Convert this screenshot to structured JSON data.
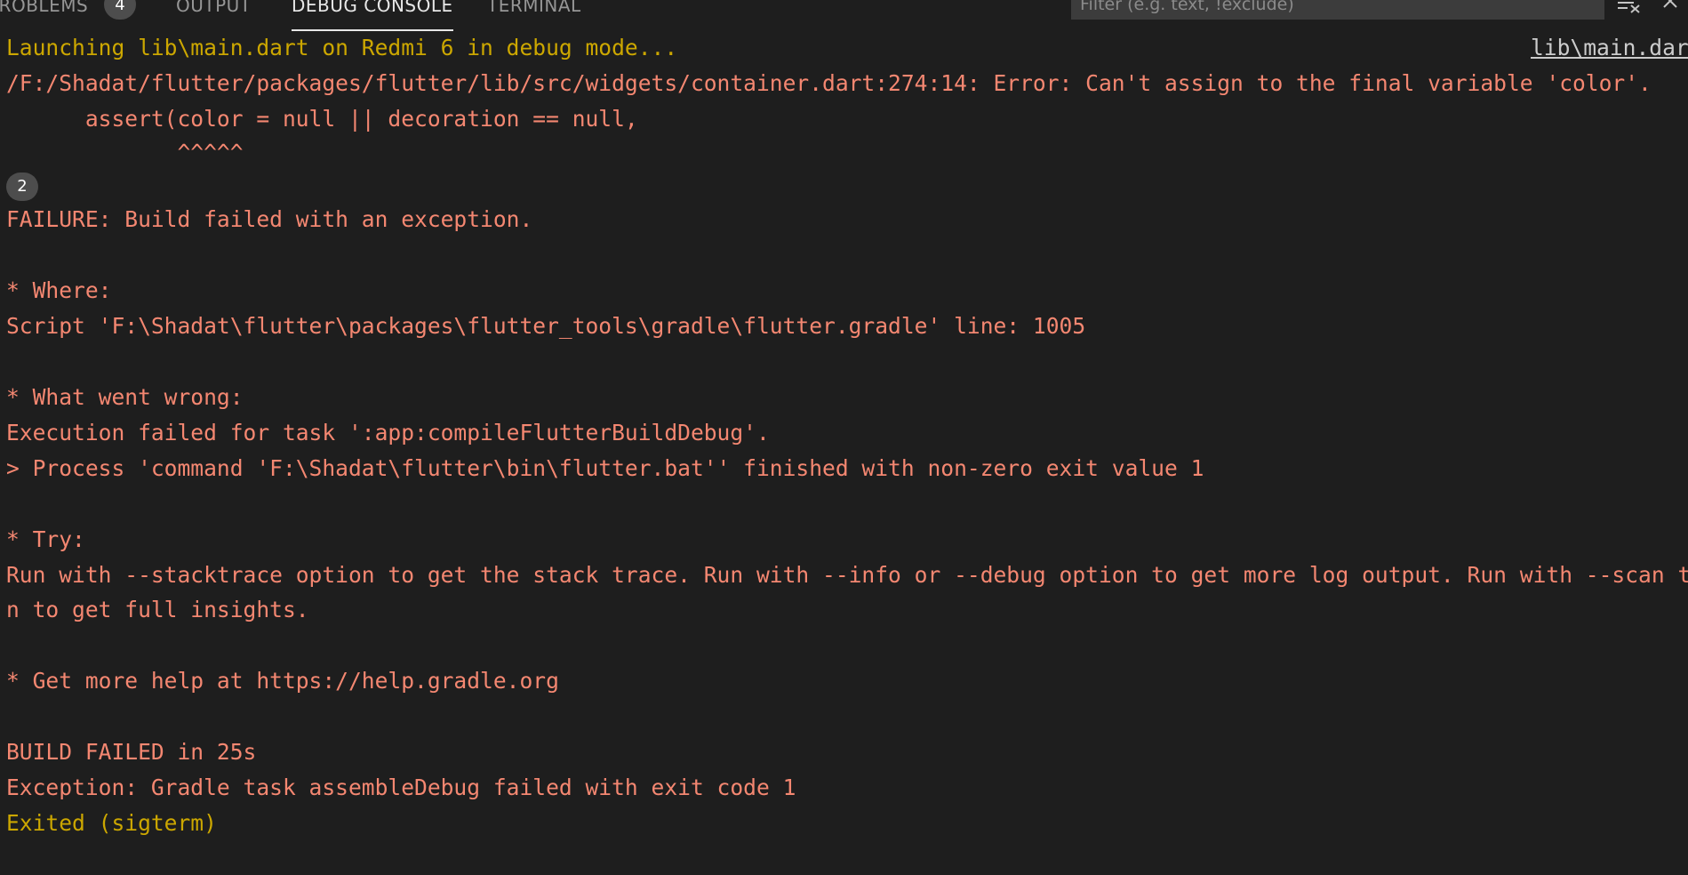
{
  "tabs": {
    "problems": {
      "label": "PROBLEMS",
      "count": "4"
    },
    "output": {
      "label": "OUTPUT"
    },
    "debug_console": {
      "label": "DEBUG CONSOLE"
    },
    "terminal": {
      "label": "TERMINAL"
    }
  },
  "filter": {
    "placeholder": "Filter (e.g. text, !exclude)",
    "value": ""
  },
  "toolbar": {
    "clear_icon": "clear-console-icon",
    "close_icon": "close-icon"
  },
  "console": {
    "launch_line": "Launching lib\\main.dart on Redmi 6 in debug mode...",
    "source_link": "lib\\main.dart",
    "error_line": "/F:/Shadat/flutter/packages/flutter/lib/src/widgets/container.dart:274:14: Error: Can't assign to the final variable 'color'.",
    "assert_line": "      assert(color = null || decoration == null,",
    "caret_line": "             ^^^^^",
    "repeat_count": "2",
    "failure_line": "FAILURE: Build failed with an exception.",
    "where_header": "* Where:",
    "where_detail": "Script 'F:\\Shadat\\flutter\\packages\\flutter_tools\\gradle\\flutter.gradle' line: 1005",
    "wrong_header": "* What went wrong:",
    "wrong_detail_1": "Execution failed for task ':app:compileFlutterBuildDebug'.",
    "wrong_detail_2": "> Process 'command 'F:\\Shadat\\flutter\\bin\\flutter.bat'' finished with non-zero exit value 1",
    "try_header": "* Try:",
    "try_detail_1": "Run with --stacktrace option to get the stack trace. Run with --info or --debug option to get more log output. Run with --scan to get full insights.",
    "try_detail_2": "n to get full insights.",
    "help_line": "* Get more help at https://help.gradle.org",
    "build_failed": "BUILD FAILED in 25s",
    "exception_line": "Exception: Gradle task assembleDebug failed with exit code 1",
    "exited_line": "Exited (sigterm)"
  },
  "colors": {
    "background": "#1e1e1e",
    "error_text": "#f48771",
    "warning_text": "#cca700",
    "link_text": "#cccccc",
    "tab_active": "#e7e7e7",
    "tab_inactive": "#969696"
  }
}
